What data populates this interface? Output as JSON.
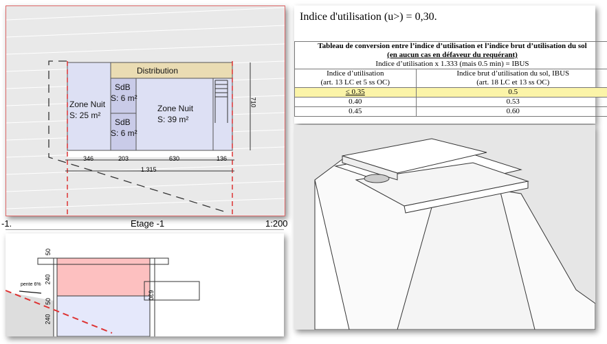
{
  "plan": {
    "rooms": [
      {
        "name": "Distribution"
      },
      {
        "name": "Zone Nuit",
        "area": "S:  25 m²"
      },
      {
        "name": "SdB",
        "area": "S: 6 m²"
      },
      {
        "name": "SdB",
        "area": "S: 6 m²"
      },
      {
        "name": "Zone Nuit",
        "area": "S:  39 m²"
      }
    ],
    "dims": [
      "346",
      "203",
      "630",
      "136",
      "1.315",
      "710"
    ]
  },
  "titlebar": {
    "left": "-1.",
    "center": "Etage -1",
    "right": "1:200"
  },
  "section": {
    "dims": [
      "50",
      "240",
      "50",
      "240",
      "630"
    ],
    "slope": "pente 6%"
  },
  "doc": {
    "heading": "Indice d'utilisation (u>) = 0,30.",
    "table": {
      "title": "Tableau de conversion entre l’indice d’utilisation et l’indice brut d’utilisation du sol",
      "subtitle": "(en aucun cas en défaveur du requérant)",
      "formula": "Indice d’utilisation x 1.333 (mais 0.5 min) = IBUS",
      "col1": [
        "Indice d’utilisation",
        "(art. 13 LC et 5 ss OC)"
      ],
      "col2": [
        "Indice brut d’utilisation du sol, IBUS",
        "(art. 18 LC et 13 ss OC)"
      ],
      "rows": [
        [
          "≤ 0.35",
          "0.5"
        ],
        [
          "0.40",
          "0.53"
        ],
        [
          "0.45",
          "0.60"
        ]
      ],
      "highlight_color": "#fbf4a8"
    }
  }
}
